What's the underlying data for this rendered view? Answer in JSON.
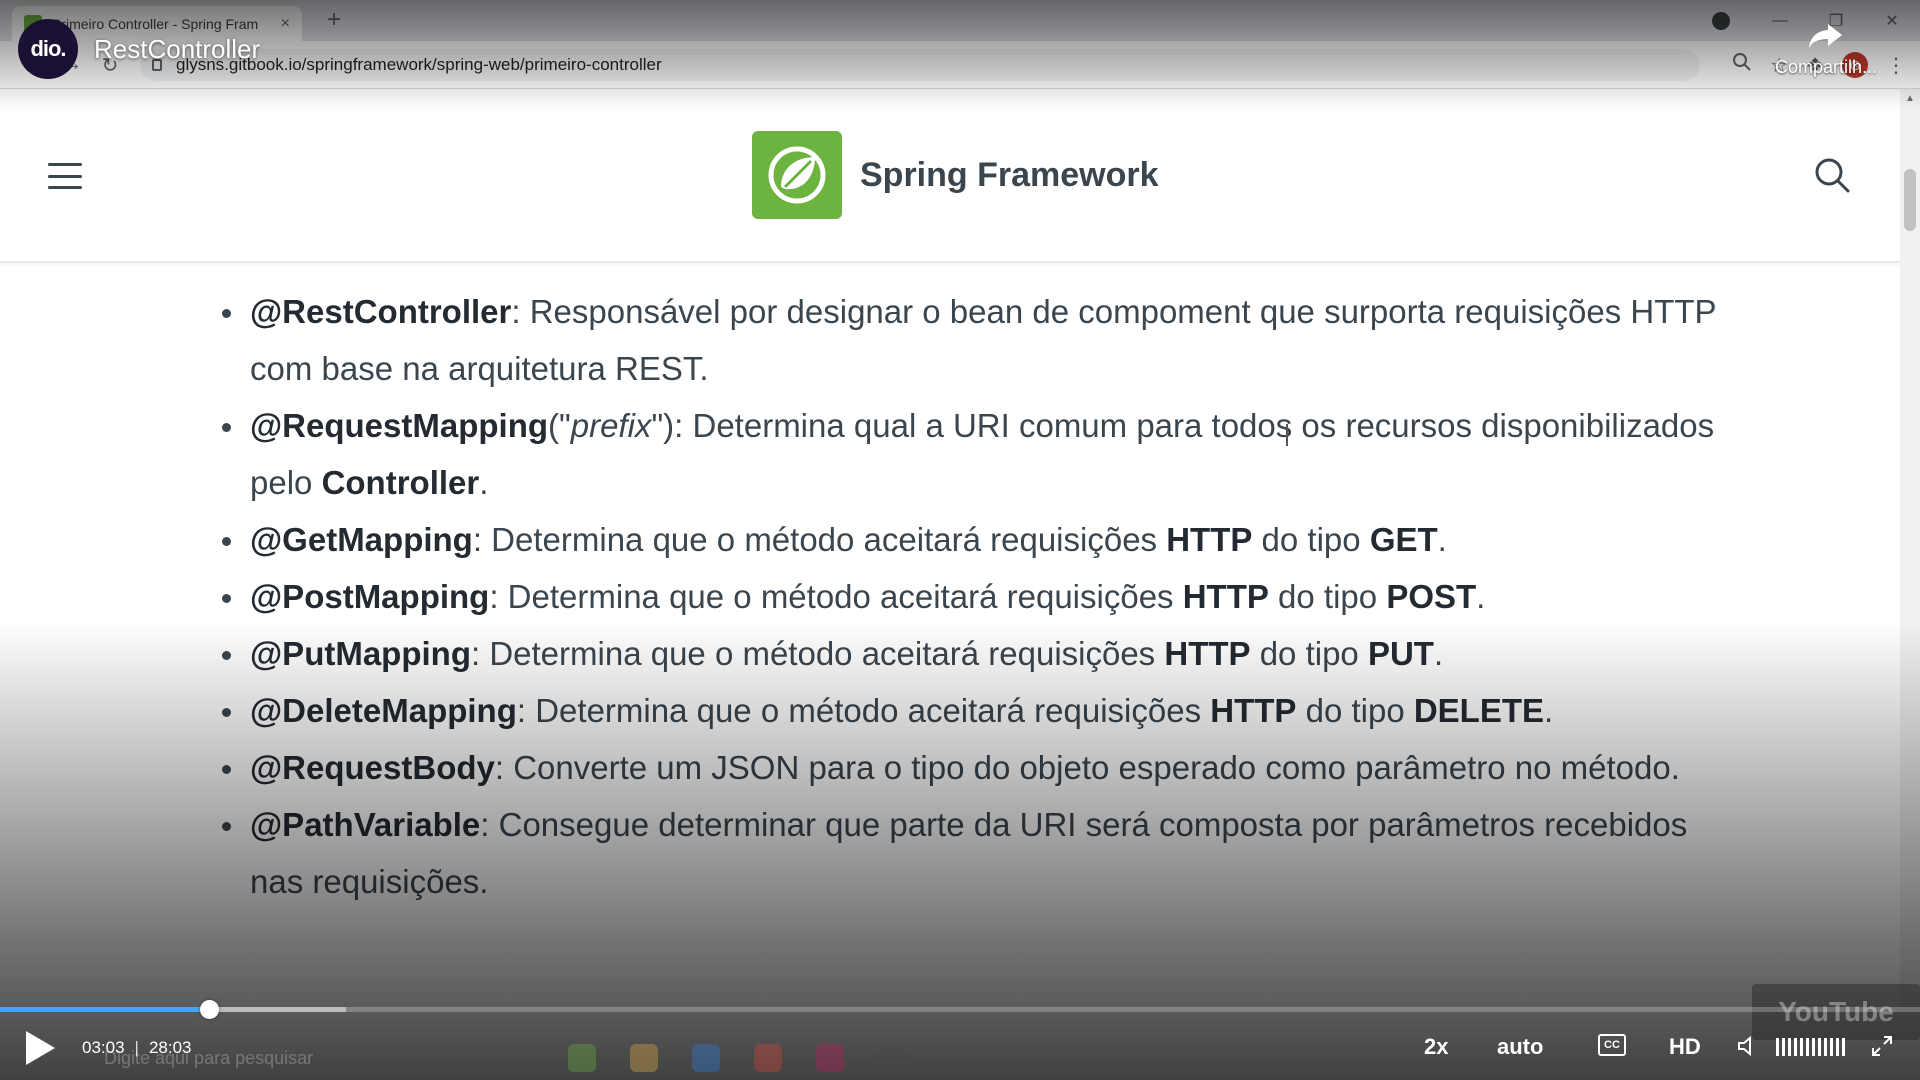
{
  "browser": {
    "tab_title": "Primeiro Controller - Spring Fram",
    "tab_close": "×",
    "new_tab": "+",
    "url": "glysns.gitbook.io/springframework/spring-web/primeiro-controller",
    "profile_initial": "G"
  },
  "site": {
    "title": "Spring Framework"
  },
  "content": {
    "items": [
      {
        "term": "@RestController",
        "text": ": Responsável por designar o bean de compoment que surporta requisições HTTP com base na arquitetura REST."
      },
      {
        "term": "@RequestMapping",
        "open": "(\"",
        "arg": "prefix",
        "close": "\")",
        "text": ": Determina qual a URI comum para todos os recursos disponibilizados pelo ",
        "bold_end": "Controller",
        "end": "."
      },
      {
        "term": "@GetMapping",
        "text1": ": Determina que o método aceitará requisições ",
        "b1": "HTTP",
        "text2": " do tipo ",
        "b2": "GET",
        "end": "."
      },
      {
        "term": "@PostMapping",
        "text1": ": Determina que o método aceitará requisições ",
        "b1": "HTTP",
        "text2": " do tipo ",
        "b2": "POST",
        "end": "."
      },
      {
        "term": "@PutMapping",
        "text1": ": Determina que o método aceitará requisições ",
        "b1": "HTTP",
        "text2": " do tipo ",
        "b2": "PUT",
        "end": "."
      },
      {
        "term": "@DeleteMapping",
        "text1": ": Determina que o método aceitará requisições ",
        "b1": "HTTP",
        "text2": " do tipo ",
        "b2": "DELETE",
        "end": "."
      },
      {
        "term": "@RequestBody",
        "text": ": Converte um JSON para o tipo do objeto esperado como parâmetro no método."
      },
      {
        "term": "@PathVariable",
        "text": ": Consegue determinar que parte da URI será composta por parâmetros recebidos nas requisições."
      }
    ]
  },
  "video": {
    "channel_logo": "dio.",
    "title": "RestController",
    "share_label": "Compartilh...",
    "current_time": "03:03",
    "time_separator": "|",
    "duration": "28:03",
    "played_fraction": 0.109,
    "buffered_fraction": 0.18,
    "speed": "2x",
    "quality": "auto",
    "cc_label": "CC",
    "hd_label": "HD",
    "watermark": "YouTube"
  },
  "taskbar": {
    "search_placeholder": "Digite aqui para pesquisar"
  },
  "colors": {
    "spring_green": "#6db33f",
    "text": "#3b454e",
    "progress": "#3ea6ff"
  }
}
